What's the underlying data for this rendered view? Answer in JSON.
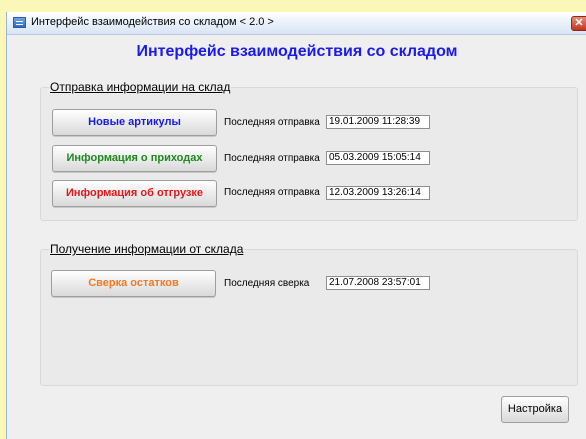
{
  "window": {
    "title": "Интерфейс взаимодействия со складом  < 2.0 >",
    "close_glyph": "✕",
    "heading": "Интерфейс взаимодействия со складом"
  },
  "send_group": {
    "title": "Отправка информации на склад",
    "rows": [
      {
        "button": "Новые артикулы",
        "button_color": "#1a1ae0",
        "label": "Последняя отправка",
        "value": "19.01.2009 11:28:39"
      },
      {
        "button": "Информация о приходах",
        "button_color": "#1d8a1d",
        "label": "Последняя отправка",
        "value": "05.03.2009 15:05:14"
      },
      {
        "button": "Информация об отгрузке",
        "button_color": "#e0181c",
        "label": "Последняя отправка",
        "value": "12.03.2009 13:26:14"
      }
    ]
  },
  "receive_group": {
    "title": "Получение информации от склада",
    "rows": [
      {
        "button": "Сверка остатков",
        "button_color": "#f07a23",
        "label": "Последняя сверка",
        "value": "21.07.2008 23:57:01"
      }
    ]
  },
  "footer": {
    "settings_label": "Настройка"
  }
}
